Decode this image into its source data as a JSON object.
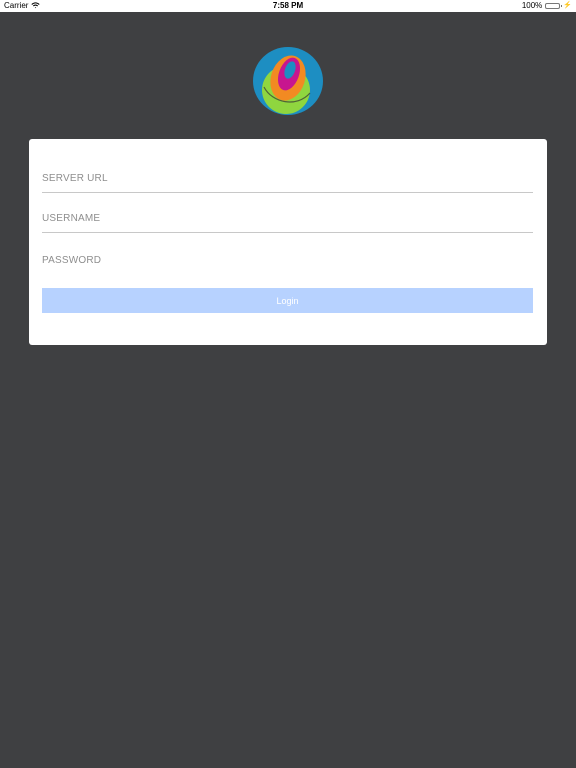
{
  "status_bar": {
    "carrier": "Carrier",
    "time": "7:58 PM",
    "battery": "100%",
    "battery_level": 1,
    "battery_color": "#4cd964"
  },
  "logo": {
    "icon_name": "app-logo-icon",
    "colors": {
      "outer": "#1d8ec2",
      "orange": "#f28a22",
      "magenta": "#c7168f",
      "green": "#8fd63f"
    }
  },
  "login_form": {
    "server_placeholder": "SERVER URL",
    "username_placeholder": "USERNAME",
    "password_placeholder": "PASSWORD",
    "login_label": "Login"
  },
  "theme": {
    "background": "#3f4042",
    "button_color": "#b7d2ff"
  }
}
